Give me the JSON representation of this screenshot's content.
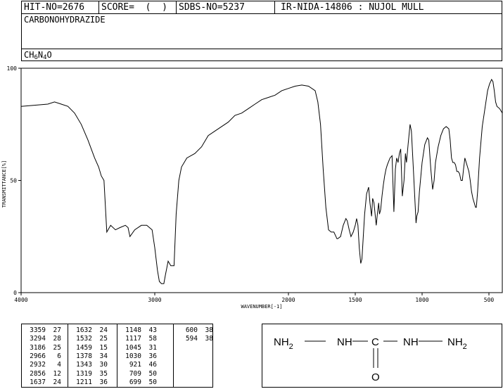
{
  "header": {
    "hit_no": "HIT-NO=2676",
    "score": "SCORE=  (  )",
    "sdbs_no": "SDBS-NO=5237",
    "ir_info": "IR-NIDA-14806 : NUJOL MULL",
    "compound_name": "CARBONOHYDRAZIDE",
    "formula": {
      "c": "CH",
      "h_count": "6",
      "n": "N",
      "n_count": "4",
      "o": "O"
    }
  },
  "chart_data": {
    "type": "line",
    "xlabel": "WAVENUMBER[-1]",
    "ylabel": "TRANSMITTANCE[%]",
    "xlim": [
      4000,
      400
    ],
    "ylim": [
      0,
      100
    ],
    "x_ticks": [
      4000,
      3000,
      2000,
      1500,
      1000,
      500
    ],
    "y_ticks": [
      0,
      50,
      100
    ],
    "grid": false,
    "line_color": "#000000",
    "points": [
      [
        4000,
        83
      ],
      [
        3900,
        83.5
      ],
      [
        3800,
        84
      ],
      [
        3750,
        85
      ],
      [
        3700,
        84
      ],
      [
        3650,
        83
      ],
      [
        3600,
        80
      ],
      [
        3550,
        75
      ],
      [
        3500,
        68
      ],
      [
        3450,
        60
      ],
      [
        3420,
        56
      ],
      [
        3400,
        52
      ],
      [
        3380,
        50
      ],
      [
        3359,
        27
      ],
      [
        3330,
        30
      ],
      [
        3294,
        28
      ],
      [
        3260,
        29
      ],
      [
        3220,
        30
      ],
      [
        3200,
        29
      ],
      [
        3186,
        25
      ],
      [
        3150,
        28
      ],
      [
        3100,
        30
      ],
      [
        3060,
        30
      ],
      [
        3020,
        28
      ],
      [
        3000,
        20
      ],
      [
        2980,
        10
      ],
      [
        2966,
        5
      ],
      [
        2950,
        4
      ],
      [
        2932,
        4
      ],
      [
        2920,
        8
      ],
      [
        2900,
        14
      ],
      [
        2880,
        12
      ],
      [
        2856,
        12
      ],
      [
        2840,
        35
      ],
      [
        2820,
        50
      ],
      [
        2800,
        56
      ],
      [
        2760,
        60
      ],
      [
        2700,
        62
      ],
      [
        2650,
        65
      ],
      [
        2600,
        70
      ],
      [
        2550,
        72
      ],
      [
        2500,
        74
      ],
      [
        2450,
        76
      ],
      [
        2400,
        79
      ],
      [
        2350,
        80
      ],
      [
        2300,
        82
      ],
      [
        2250,
        84
      ],
      [
        2200,
        86
      ],
      [
        2150,
        87
      ],
      [
        2100,
        88
      ],
      [
        2050,
        90
      ],
      [
        2000,
        91
      ],
      [
        1950,
        92
      ],
      [
        1900,
        92.5
      ],
      [
        1850,
        92
      ],
      [
        1800,
        90
      ],
      [
        1780,
        85
      ],
      [
        1760,
        75
      ],
      [
        1740,
        55
      ],
      [
        1720,
        38
      ],
      [
        1700,
        28
      ],
      [
        1680,
        27
      ],
      [
        1660,
        27
      ],
      [
        1637,
        24
      ],
      [
        1632,
        24
      ],
      [
        1610,
        25
      ],
      [
        1590,
        30
      ],
      [
        1570,
        33
      ],
      [
        1560,
        32
      ],
      [
        1545,
        28
      ],
      [
        1532,
        25
      ],
      [
        1515,
        27
      ],
      [
        1500,
        30
      ],
      [
        1490,
        33
      ],
      [
        1480,
        30
      ],
      [
        1470,
        20
      ],
      [
        1459,
        13
      ],
      [
        1450,
        15
      ],
      [
        1440,
        25
      ],
      [
        1430,
        35
      ],
      [
        1415,
        44
      ],
      [
        1400,
        47
      ],
      [
        1390,
        40
      ],
      [
        1378,
        34
      ],
      [
        1370,
        42
      ],
      [
        1360,
        40
      ],
      [
        1343,
        30
      ],
      [
        1335,
        35
      ],
      [
        1325,
        40
      ],
      [
        1319,
        35
      ],
      [
        1310,
        37
      ],
      [
        1300,
        43
      ],
      [
        1290,
        48
      ],
      [
        1280,
        52
      ],
      [
        1270,
        55
      ],
      [
        1260,
        57
      ],
      [
        1240,
        60
      ],
      [
        1225,
        61
      ],
      [
        1211,
        36
      ],
      [
        1200,
        55
      ],
      [
        1190,
        60
      ],
      [
        1180,
        58
      ],
      [
        1170,
        62
      ],
      [
        1160,
        64
      ],
      [
        1148,
        43
      ],
      [
        1135,
        50
      ],
      [
        1125,
        62
      ],
      [
        1117,
        58
      ],
      [
        1105,
        66
      ],
      [
        1090,
        75
      ],
      [
        1080,
        72
      ],
      [
        1065,
        55
      ],
      [
        1045,
        31
      ],
      [
        1040,
        34
      ],
      [
        1030,
        36
      ],
      [
        1020,
        45
      ],
      [
        1000,
        58
      ],
      [
        980,
        66
      ],
      [
        960,
        69
      ],
      [
        950,
        68
      ],
      [
        935,
        55
      ],
      [
        921,
        46
      ],
      [
        910,
        50
      ],
      [
        900,
        58
      ],
      [
        880,
        65
      ],
      [
        860,
        70
      ],
      [
        840,
        73
      ],
      [
        820,
        74
      ],
      [
        800,
        73
      ],
      [
        790,
        68
      ],
      [
        780,
        60
      ],
      [
        770,
        58
      ],
      [
        760,
        58
      ],
      [
        750,
        57
      ],
      [
        740,
        54
      ],
      [
        730,
        54
      ],
      [
        720,
        53
      ],
      [
        709,
        50
      ],
      [
        699,
        50
      ],
      [
        690,
        55
      ],
      [
        680,
        60
      ],
      [
        670,
        58
      ],
      [
        660,
        56
      ],
      [
        650,
        54
      ],
      [
        640,
        50
      ],
      [
        630,
        45
      ],
      [
        620,
        42
      ],
      [
        610,
        40
      ],
      [
        600,
        38
      ],
      [
        594,
        38
      ],
      [
        585,
        45
      ],
      [
        570,
        60
      ],
      [
        550,
        74
      ],
      [
        530,
        82
      ],
      [
        510,
        90
      ],
      [
        495,
        93
      ],
      [
        480,
        95
      ],
      [
        470,
        94
      ],
      [
        460,
        90
      ],
      [
        450,
        85
      ],
      [
        440,
        83
      ],
      [
        420,
        82
      ],
      [
        400,
        80
      ]
    ],
    "peak_table": [
      [
        "3359",
        "27"
      ],
      [
        "3294",
        "28"
      ],
      [
        "3186",
        "25"
      ],
      [
        "2966",
        "6"
      ],
      [
        "2932",
        "4"
      ],
      [
        "2856",
        "12"
      ],
      [
        "1637",
        "24"
      ],
      [
        "1632",
        "24"
      ],
      [
        "1532",
        "25"
      ],
      [
        "1459",
        "15"
      ],
      [
        "1378",
        "34"
      ],
      [
        "1343",
        "30"
      ],
      [
        "1319",
        "35"
      ],
      [
        "1211",
        "36"
      ],
      [
        "1148",
        "43"
      ],
      [
        "1117",
        "58"
      ],
      [
        "1045",
        "31"
      ],
      [
        "1030",
        "36"
      ],
      [
        "921",
        "46"
      ],
      [
        "709",
        "50"
      ],
      [
        "699",
        "50"
      ],
      [
        "600",
        "38"
      ],
      [
        "594",
        "38"
      ]
    ]
  },
  "structure": {
    "atoms": [
      "NH",
      "NH",
      "C",
      "NH",
      "NH",
      "O"
    ],
    "sub2": "2"
  }
}
